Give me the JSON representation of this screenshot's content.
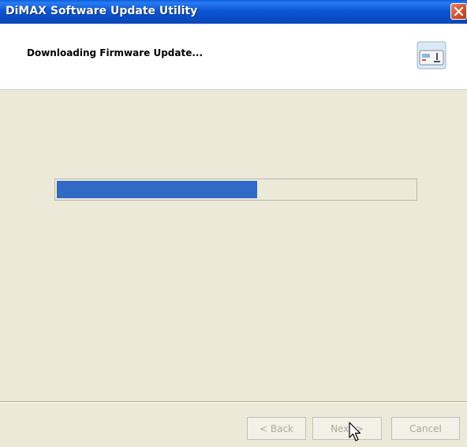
{
  "window": {
    "title": "DiMAX Software Update Utility"
  },
  "header": {
    "heading": "Downloading Firmware Update...",
    "icon": "device-icon"
  },
  "progress": {
    "fraction": 0.56,
    "color": "#3169c6"
  },
  "buttons": {
    "back_label": "< Back",
    "next_label": "Next >",
    "cancel_label": "Cancel"
  },
  "colors": {
    "titlebar": "#0b56d6",
    "dialog_bg": "#ece9d8",
    "disabled_text": "#aca899",
    "close_button": "#d9532c"
  }
}
